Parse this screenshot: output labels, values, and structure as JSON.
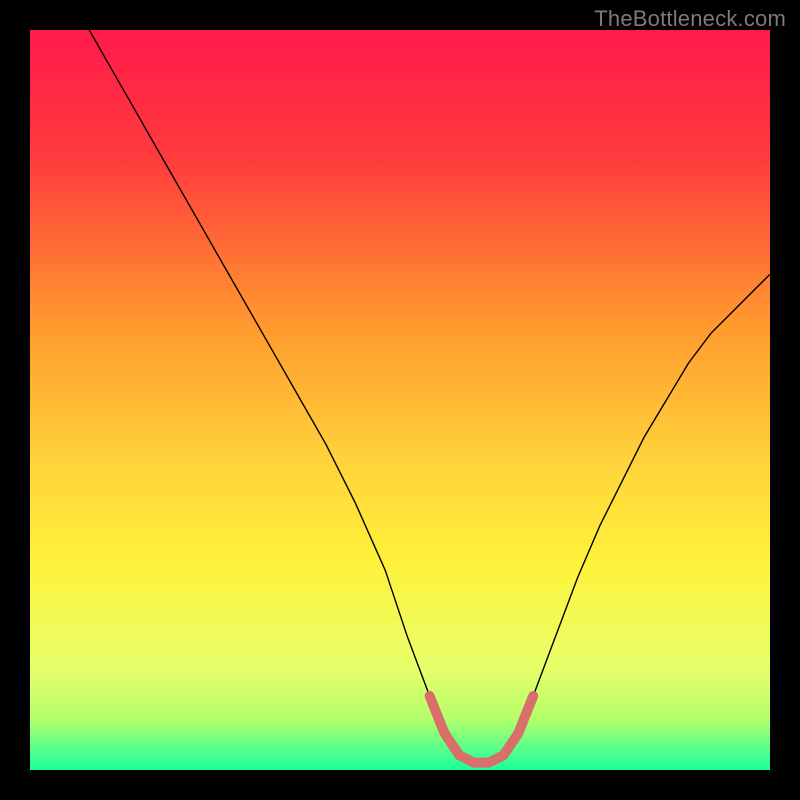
{
  "watermark": "TheBottleneck.com",
  "chart_data": {
    "type": "line",
    "title": "",
    "xlabel": "",
    "ylabel": "",
    "xlim": [
      0,
      100
    ],
    "ylim": [
      0,
      100
    ],
    "background_gradient": {
      "stops": [
        {
          "offset": 0,
          "color": "#ff1a4b"
        },
        {
          "offset": 18,
          "color": "#ff3d3d"
        },
        {
          "offset": 40,
          "color": "#ff9a2e"
        },
        {
          "offset": 58,
          "color": "#ffd23a"
        },
        {
          "offset": 72,
          "color": "#fff23a"
        },
        {
          "offset": 86,
          "color": "#e8ff6a"
        },
        {
          "offset": 93,
          "color": "#b6ff6a"
        },
        {
          "offset": 97,
          "color": "#5bff8a"
        },
        {
          "offset": 100,
          "color": "#1aff9a"
        }
      ]
    },
    "series": [
      {
        "name": "bottleneck-curve",
        "color": "#000000",
        "width": 1.4,
        "x": [
          8,
          12,
          16,
          20,
          24,
          28,
          32,
          36,
          40,
          44,
          48,
          51,
          54,
          56,
          58,
          60,
          62,
          64,
          66,
          68,
          71,
          74,
          77,
          80,
          83,
          86,
          89,
          92,
          95,
          98,
          100
        ],
        "y": [
          100,
          93,
          86,
          79,
          72,
          65,
          58,
          51,
          44,
          36,
          27,
          18,
          10,
          5,
          2,
          1,
          1,
          2,
          5,
          10,
          18,
          26,
          33,
          39,
          45,
          50,
          55,
          59,
          62,
          65,
          67
        ]
      }
    ],
    "highlight": {
      "name": "optimal-zone",
      "color": "#d96f6a",
      "width": 10,
      "x": [
        54,
        56,
        58,
        60,
        62,
        64,
        66,
        68
      ],
      "y": [
        10,
        5,
        2,
        1,
        1,
        2,
        5,
        10
      ]
    }
  }
}
